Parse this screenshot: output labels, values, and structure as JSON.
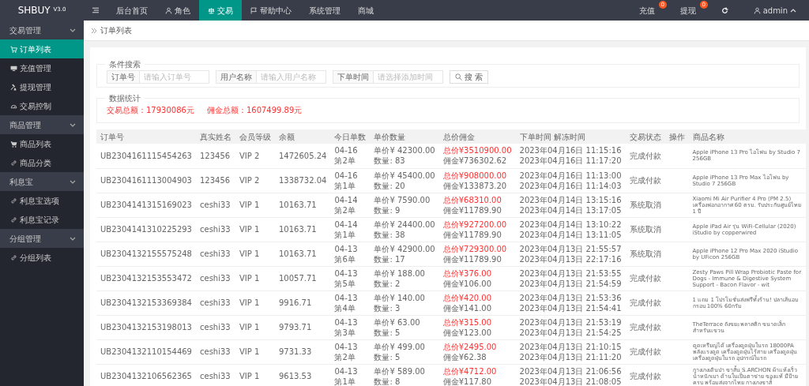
{
  "brand": {
    "name": "SHBUY",
    "version": "V3.0"
  },
  "top_nav": [
    {
      "label": "后台首页",
      "kind": "plain",
      "selected": false
    },
    {
      "label": "角色",
      "kind": "user",
      "selected": false
    },
    {
      "label": "交易",
      "kind": "scale",
      "selected": true
    },
    {
      "label": "帮助中心",
      "kind": "flag",
      "selected": false
    },
    {
      "label": "系统管理",
      "kind": "plain",
      "selected": false
    },
    {
      "label": "商城",
      "kind": "plain",
      "selected": false
    }
  ],
  "top_right": {
    "badges": [
      {
        "label": "充值",
        "badge": "0"
      },
      {
        "label": "提现",
        "badge": "0"
      }
    ],
    "user": "admin"
  },
  "sidebar": [
    {
      "label": "交易管理",
      "expanded": true,
      "children": [
        {
          "label": "订单列表",
          "kind": "cart",
          "selected": true
        },
        {
          "label": "充值管理",
          "kind": "monitor",
          "selected": false
        },
        {
          "label": "提现管理",
          "kind": "gavel",
          "selected": false
        },
        {
          "label": "交易控制",
          "kind": "gauge",
          "selected": false
        }
      ]
    },
    {
      "label": "商品管理",
      "expanded": true,
      "children": [
        {
          "label": "商品列表",
          "kind": "cartfilled",
          "selected": false
        },
        {
          "label": "商品分类",
          "kind": "link",
          "selected": false
        }
      ]
    },
    {
      "label": "利息宝",
      "expanded": true,
      "children": [
        {
          "label": "利息宝选项",
          "kind": "link",
          "selected": false
        },
        {
          "label": "利息宝记录",
          "kind": "link",
          "selected": false
        }
      ]
    },
    {
      "label": "分组管理",
      "expanded": true,
      "children": [
        {
          "label": "分组列表",
          "kind": "link",
          "selected": false
        }
      ]
    }
  ],
  "breadcrumb": "订单列表",
  "search": {
    "title": "条件搜索",
    "fields": [
      {
        "label": "订单号",
        "placeholder": "请输入订单号"
      },
      {
        "label": "用户名称",
        "placeholder": "请输入用户名称"
      },
      {
        "label": "下单时间",
        "placeholder": "请选择添加时间"
      }
    ],
    "button": "搜 索"
  },
  "stats": {
    "title": "数据统计",
    "items": [
      "交易总额：17930086元",
      "佣金总额：1607499.89元"
    ]
  },
  "table": {
    "columns": [
      "订单号",
      "真实姓名",
      "会员等级",
      "余额",
      "今日单数",
      "单价数量",
      "总价佣金",
      "下单时间 解冻时间",
      "交易状态",
      "操作",
      "商品名称"
    ],
    "rows": [
      {
        "order_no": "UB2304161115454263",
        "name": "123456",
        "level": "VIP 2",
        "balance": "1472605.24",
        "date": "04-16",
        "count": "第2单",
        "price": "单价¥ 42300.00",
        "quantity": "数量: 83",
        "total": "总价¥3510900.00",
        "commission": "佣金¥736302.62",
        "order_time": "2023年04月16日 11:15:16",
        "unfreeze_time": "2023年04月16日 11:17:20",
        "status": "完成付款",
        "product": "Apple iPhone 13 Pro ไอโฟน by Studio 7 256GB"
      },
      {
        "order_no": "UB2304161113004903",
        "name": "123456",
        "level": "VIP 2",
        "balance": "1338732.04",
        "date": "04-16",
        "count": "第1单",
        "price": "单价¥ 45400.00",
        "quantity": "数量: 20",
        "total": "总价¥908000.00",
        "commission": "佣金¥133873.20",
        "order_time": "2023年04月16日 11:13:00",
        "unfreeze_time": "2023年04月16日 11:14:03",
        "status": "完成付款",
        "product": "Apple iPhone 13 Pro Max ไอโฟน by Studio 7 256GB"
      },
      {
        "order_no": "UB2304141315169023",
        "name": "ceshi33",
        "level": "VIP 1",
        "balance": "10163.71",
        "date": "04-14",
        "count": "第2单",
        "price": "单价¥ 7590.00",
        "quantity": "数量: 9",
        "total": "总价¥68310.00",
        "commission": "佣金¥11789.90",
        "order_time": "2023年04月14日 13:15:16",
        "unfreeze_time": "2023年04月14日 13:17:05",
        "status": "系统取消",
        "product": "Xiaomi Mi Air Purifier 4 Pro (PM 2.5) เครื่องฟอกอากาศ 60 ตรม. รับประกันศูนย์ไทย 1 ปี"
      },
      {
        "order_no": "UB2304141310225293",
        "name": "ceshi33",
        "level": "VIP 1",
        "balance": "10163.71",
        "date": "04-14",
        "count": "第1单",
        "price": "单价¥ 24400.00",
        "quantity": "数量: 38",
        "total": "总价¥927200.00",
        "commission": "佣金¥11789.90",
        "order_time": "2023年04月14日 13:10:22",
        "unfreeze_time": "2023年04月14日 13:11:05",
        "status": "系统取消",
        "product": "Apple iPad Air รุ่น WiFi-Cellular (2020) iStudio by copperwired"
      },
      {
        "order_no": "UB2304132155575248",
        "name": "ceshi33",
        "level": "VIP 1",
        "balance": "10163.71",
        "date": "04-13",
        "count": "第6单",
        "price": "单价¥ 42900.00",
        "quantity": "数量: 17",
        "total": "总价¥729300.00",
        "commission": "佣金¥11789.90",
        "order_time": "2023年04月13日 21:55:57",
        "unfreeze_time": "2023年04月13日 22:17:16",
        "status": "系统取消",
        "product": "Apple iPhone 12 Pro Max 2020 iStudio by UFicon 256GB"
      },
      {
        "order_no": "UB2304132153553472",
        "name": "ceshi33",
        "level": "VIP 1",
        "balance": "10057.71",
        "date": "04-13",
        "count": "第5单",
        "price": "单价¥ 188.00",
        "quantity": "数量: 2",
        "total": "总价¥376.00",
        "commission": "佣金¥106.00",
        "order_time": "2023年04月13日 21:53:55",
        "unfreeze_time": "2023年04月13日 21:54:59",
        "status": "完成付款",
        "product": "Zesty Paws Pill Wrap Probiotic Paste for Dogs - Immune & Digestive System Support - Bacon Flavor - wit"
      },
      {
        "order_no": "UB2304132153369384",
        "name": "ceshi33",
        "level": "VIP 1",
        "balance": "9916.71",
        "date": "04-13",
        "count": "第4单",
        "price": "单价¥ 140.00",
        "quantity": "数量: 3",
        "total": "总价¥420.00",
        "commission": "佣金¥141.00",
        "order_time": "2023年04月13日 21:53:36",
        "unfreeze_time": "2023年04月13日 21:54:41",
        "status": "完成付款",
        "product": "1 แถม 1 โปรโมชั่นส่งฟรีทั้งร้าน! ปลาเส้นอบกรอบ 100% 60กรัม"
      },
      {
        "order_no": "UB2304132153198013",
        "name": "ceshi33",
        "level": "VIP 1",
        "balance": "9793.71",
        "date": "04-13",
        "count": "第3单",
        "price": "单价¥ 63.00",
        "quantity": "数量: 5",
        "total": "总价¥315.00",
        "commission": "佣金¥123.00",
        "order_time": "2023年04月13日 21:53:19",
        "unfreeze_time": "2023年04月13日 21:54:25",
        "status": "完成付款",
        "product": "TheTerrace ถังขยะพลาสติก ขนาดเล็ก สำหรับแขวน"
      },
      {
        "order_no": "UB2304132110154469",
        "name": "ceshi33",
        "level": "VIP 1",
        "balance": "9731.33",
        "date": "04-13",
        "count": "第2单",
        "price": "单价¥ 499.00",
        "quantity": "数量: 5",
        "total": "总价¥2495.00",
        "commission": "佣金¥62.38",
        "order_time": "2023年04月13日 21:10:15",
        "unfreeze_time": "2023年04月13日 21:11:20",
        "status": "完成付款",
        "product": "ดูดเหรียญได้ เครื่องดูดฝุ่นในรถ 18000PA พลังแรงดูด เครื่องดูดฝุ่นไร้สาย เครื่องดูดฝุ่น เครื่องดูดฝุ่นในรถ อุปกรณ์ในรถ"
      },
      {
        "order_no": "UB2304132106562365",
        "name": "ceshi33",
        "level": "VIP 1",
        "balance": "9613.53",
        "date": "04-13",
        "count": "第1单",
        "price": "单价¥ 589.00",
        "quantity": "数量: 8",
        "total": "总价¥4712.00",
        "commission": "佣金¥117.80",
        "order_time": "2023年04月13日 21:06:56",
        "unfreeze_time": "2023年04月13日 21:08:05",
        "status": "完成付款",
        "product": "กางเกงเดินป่า ขาสั้น S.ARCHON ผ้าแห้งเร็ว น้ำหนักเบา ด้านในเป็นตาข่าย ของแท้ มีป้ายครบ พร้อมส่งจากไทย กางเกงขาสั้"
      }
    ]
  }
}
